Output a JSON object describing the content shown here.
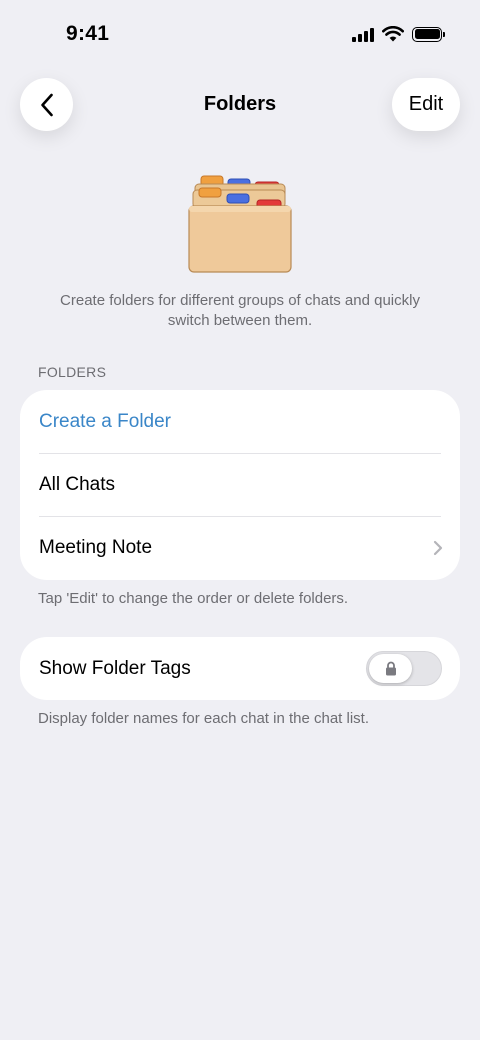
{
  "status_bar": {
    "time": "9:41",
    "icons": [
      "signal-icon",
      "wifi-icon",
      "battery-icon"
    ]
  },
  "nav": {
    "back_icon": "chevron-left-icon",
    "title": "Folders",
    "edit_label": "Edit"
  },
  "illustration": {
    "icon": "file-folders-icon"
  },
  "intro_text": "Create folders for different groups of chats and quickly switch between them.",
  "folders_section": {
    "header": "FOLDERS",
    "rows": [
      {
        "label": "Create a Folder",
        "accent": true
      },
      {
        "label": "All Chats"
      },
      {
        "label": "Meeting Note",
        "chevron": true
      }
    ],
    "footer": "Tap 'Edit' to change the order or delete folders."
  },
  "tags_section": {
    "label": "Show Folder Tags",
    "toggle_on": false,
    "toggle_locked": true,
    "footer": "Display folder names for each chat in the chat list."
  },
  "colors": {
    "background": "#efeff4",
    "accent": "#3a86c8",
    "secondary_text": "#6d6d72"
  }
}
